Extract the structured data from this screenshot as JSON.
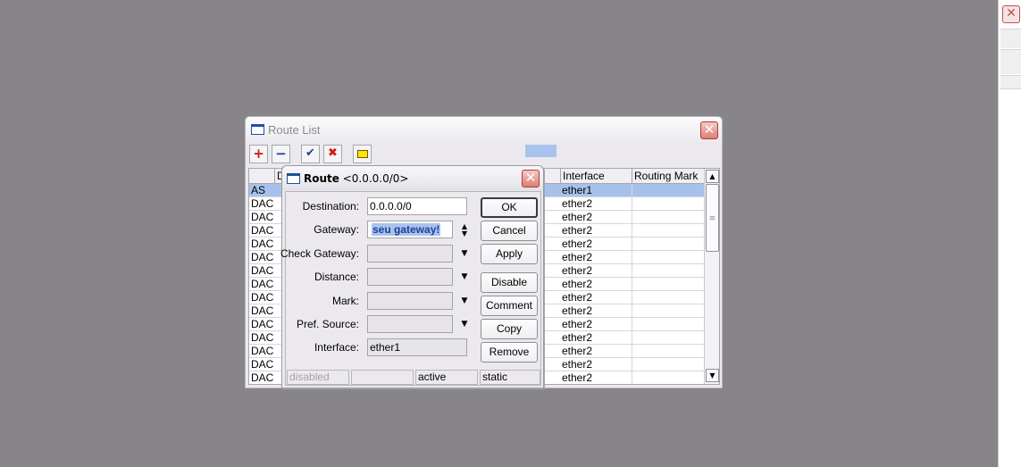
{
  "route_list": {
    "title": "Route List",
    "toolbar": {
      "add": "+",
      "remove": "−",
      "enable": "✔",
      "disable": "✖",
      "comment": "▭"
    },
    "columns": {
      "flags": "",
      "destination": "D",
      "interface": "Interface",
      "routing_mark": "Routing Mark"
    },
    "rows": [
      {
        "flag": "AS",
        "interface": "ether1"
      },
      {
        "flag": "DAC",
        "interface": "ether2"
      },
      {
        "flag": "DAC",
        "interface": "ether2"
      },
      {
        "flag": "DAC",
        "interface": "ether2"
      },
      {
        "flag": "DAC",
        "interface": "ether2"
      },
      {
        "flag": "DAC",
        "interface": "ether2"
      },
      {
        "flag": "DAC",
        "interface": "ether2"
      },
      {
        "flag": "DAC",
        "interface": "ether2"
      },
      {
        "flag": "DAC",
        "interface": "ether2"
      },
      {
        "flag": "DAC",
        "interface": "ether2"
      },
      {
        "flag": "DAC",
        "interface": "ether2"
      },
      {
        "flag": "DAC",
        "interface": "ether2"
      },
      {
        "flag": "DAC",
        "interface": "ether2"
      },
      {
        "flag": "DAC",
        "interface": "ether2"
      },
      {
        "flag": "DAC",
        "interface": "ether2"
      }
    ]
  },
  "route_dialog": {
    "title_bold": "Route",
    "title_rest": " <0.0.0.0/0>",
    "fields": {
      "destination_label": "Destination:",
      "destination_value": "0.0.0.0/0",
      "gateway_label": "Gateway:",
      "gateway_value": "seu gateway!",
      "check_gateway_label": "Check Gateway:",
      "distance_label": "Distance:",
      "mark_label": "Mark:",
      "pref_source_label": "Pref. Source:",
      "interface_label": "Interface:",
      "interface_value": "ether1"
    },
    "buttons": {
      "ok": "OK",
      "cancel": "Cancel",
      "apply": "Apply",
      "disable": "Disable",
      "comment": "Comment",
      "copy": "Copy",
      "remove": "Remove"
    },
    "status": {
      "disabled": "disabled",
      "middle": "",
      "active": "active",
      "static": "static"
    }
  },
  "colors": {
    "desktop": "#878587",
    "window": "#ece9ee",
    "selection": "#a7c2ea",
    "close_red": "#dd8075"
  }
}
